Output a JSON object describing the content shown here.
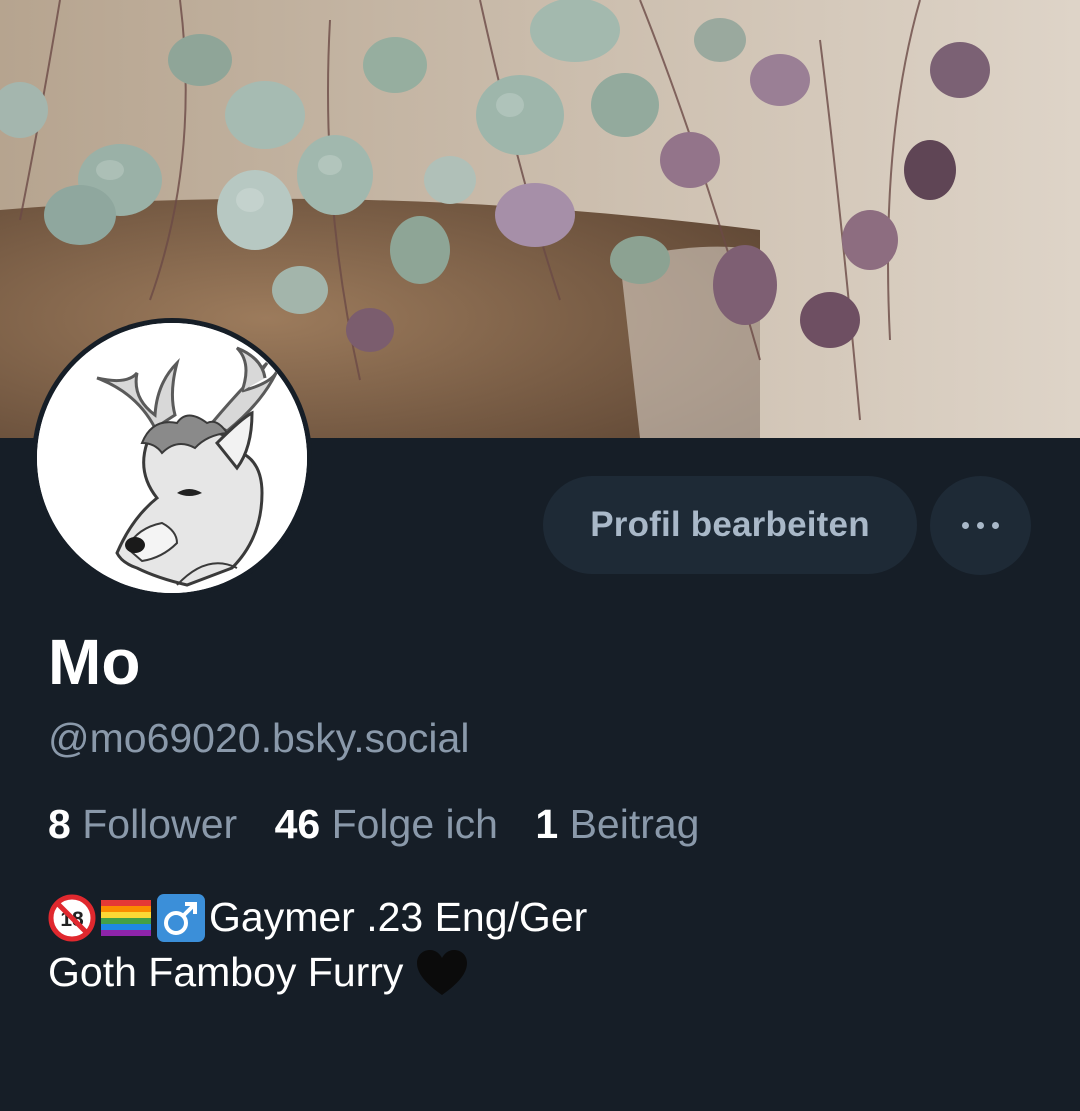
{
  "profile": {
    "display_name": "Mo",
    "handle": "@mo69020.bsky.social"
  },
  "actions": {
    "edit_label": "Profil bearbeiten",
    "more_icon": "more-horizontal-icon"
  },
  "stats": {
    "followers_count": "8",
    "followers_label": "Follower",
    "following_count": "46",
    "following_label": "Folge ich",
    "posts_count": "1",
    "posts_label": "Beitrag"
  },
  "bio": {
    "line1_emojis": [
      "no-under-18-emoji",
      "rainbow-flag-emoji",
      "male-sign-emoji"
    ],
    "line1_text": "Gaymer .23 Eng/Ger",
    "line2_text": "Goth Famboy Furry",
    "line2_emoji": "black-heart-emoji",
    "badge_18_text": "18"
  },
  "colors": {
    "background": "#161e27",
    "button_bg": "#1e2a36",
    "button_text": "#a9b8c8",
    "muted_text": "#8a99aa",
    "primary_text": "#ffffff"
  }
}
